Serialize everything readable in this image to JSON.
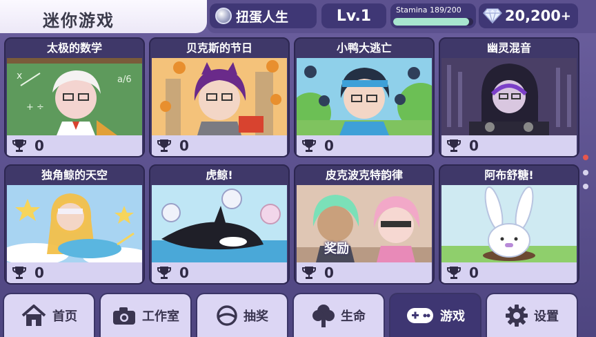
{
  "header": {
    "title": "迷你游戏",
    "gacha_name": "扭蛋人生",
    "level": "Lv.1",
    "stamina_label": "Stamina 189/200",
    "stamina_fraction": 0.945,
    "gems": "20,200",
    "plus": "+"
  },
  "games": [
    {
      "name": "太极的数学",
      "score": "0"
    },
    {
      "name": "贝克斯的节日",
      "score": "0"
    },
    {
      "name": "小鸭大逃亡",
      "score": "0"
    },
    {
      "name": "幽灵混音",
      "score": "0"
    },
    {
      "name": "独角鲸的天空",
      "score": "0"
    },
    {
      "name": "虎鲸!",
      "score": "0"
    },
    {
      "name": "皮克波克特韵律",
      "score": "0",
      "overlay": "奖励"
    },
    {
      "name": "阿布舒糖!",
      "score": "0"
    }
  ],
  "nav": [
    {
      "label": "首页",
      "icon": "home-icon"
    },
    {
      "label": "工作室",
      "icon": "camera-icon"
    },
    {
      "label": "抽奖",
      "icon": "gacha-orb-icon"
    },
    {
      "label": "生命",
      "icon": "tree-icon"
    },
    {
      "label": "游戏",
      "icon": "gamepad-icon",
      "active": true
    },
    {
      "label": "设置",
      "icon": "gear-icon"
    }
  ],
  "colors": {
    "accent": "#3e3672",
    "card_footer": "#d7d2f2",
    "stamina_fill": "#a8e5cf",
    "page_dot_active": "#e8574e"
  }
}
